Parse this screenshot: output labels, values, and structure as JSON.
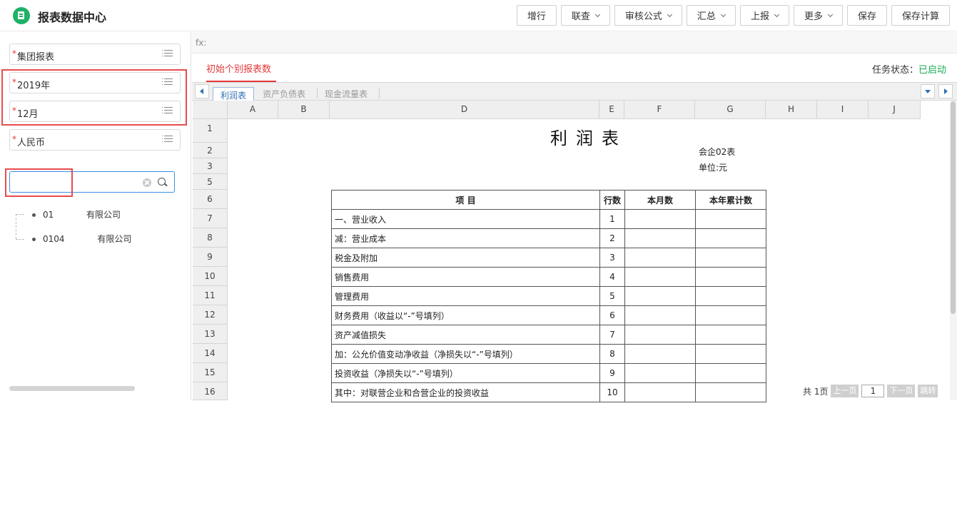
{
  "header": {
    "title": "报表数据中心",
    "toolbar": [
      {
        "label": "增行",
        "dropdown": false
      },
      {
        "label": "联查",
        "dropdown": true
      },
      {
        "label": "审核公式",
        "dropdown": true
      },
      {
        "label": "汇总",
        "dropdown": true
      },
      {
        "label": "上报",
        "dropdown": true
      },
      {
        "label": "更多",
        "dropdown": true
      },
      {
        "label": "保存",
        "dropdown": false
      },
      {
        "label": "保存计算",
        "dropdown": false
      }
    ]
  },
  "left": {
    "required_mark": "*",
    "selectors": [
      {
        "value": "集团报表"
      },
      {
        "value": "2019年"
      },
      {
        "value": "12月"
      },
      {
        "value": "人民币"
      }
    ],
    "search": {
      "value": "",
      "placeholder": ""
    },
    "tree": [
      {
        "label": "01            有限公司"
      },
      {
        "label": "0104            有限公司"
      }
    ]
  },
  "fx_label": "fx:",
  "report_tab": "初始个别报表数",
  "task_status": {
    "label": "任务状态：",
    "value": "已启动"
  },
  "sheet_tabs": [
    "利润表",
    "资产负债表",
    "现金流量表"
  ],
  "columns": [
    "A",
    "B",
    "D",
    "E",
    "F",
    "G",
    "H",
    "I",
    "J"
  ],
  "rows": [
    "1",
    "2",
    "3",
    "5",
    "6",
    "7",
    "8",
    "9",
    "10",
    "11",
    "12",
    "13",
    "14",
    "15",
    "16"
  ],
  "sheet": {
    "title": "利润表",
    "form_no": "会企02表",
    "unit": "单位:元",
    "table_headers": [
      "项  目",
      "行数",
      "本月数",
      "本年累计数"
    ],
    "table_rows": [
      {
        "item": "一、营业收入",
        "line": "1"
      },
      {
        "item": "减：营业成本",
        "line": "2"
      },
      {
        "item": "税金及附加",
        "line": "3"
      },
      {
        "item": "销售费用",
        "line": "4"
      },
      {
        "item": "管理费用",
        "line": "5"
      },
      {
        "item": "财务费用（收益以“-”号填列）",
        "line": "6"
      },
      {
        "item": "资产减值损失",
        "line": "7"
      },
      {
        "item": "加：公允价值变动净收益（净损失以“-”号填列）",
        "line": "8"
      },
      {
        "item": "投资收益（净损失以“-”号填列）",
        "line": "9"
      },
      {
        "item": "其中：对联营企业和合营企业的投资收益",
        "line": "10"
      }
    ]
  },
  "pager": {
    "total": "共 1页",
    "prev": "上一页",
    "page": "1",
    "next": "下一页",
    "jump": "跳转"
  },
  "colors": {
    "accent": "#e4393c",
    "status": "#1aaa55",
    "brand": "#1fb167",
    "highlight_box": "#e74c4c"
  }
}
